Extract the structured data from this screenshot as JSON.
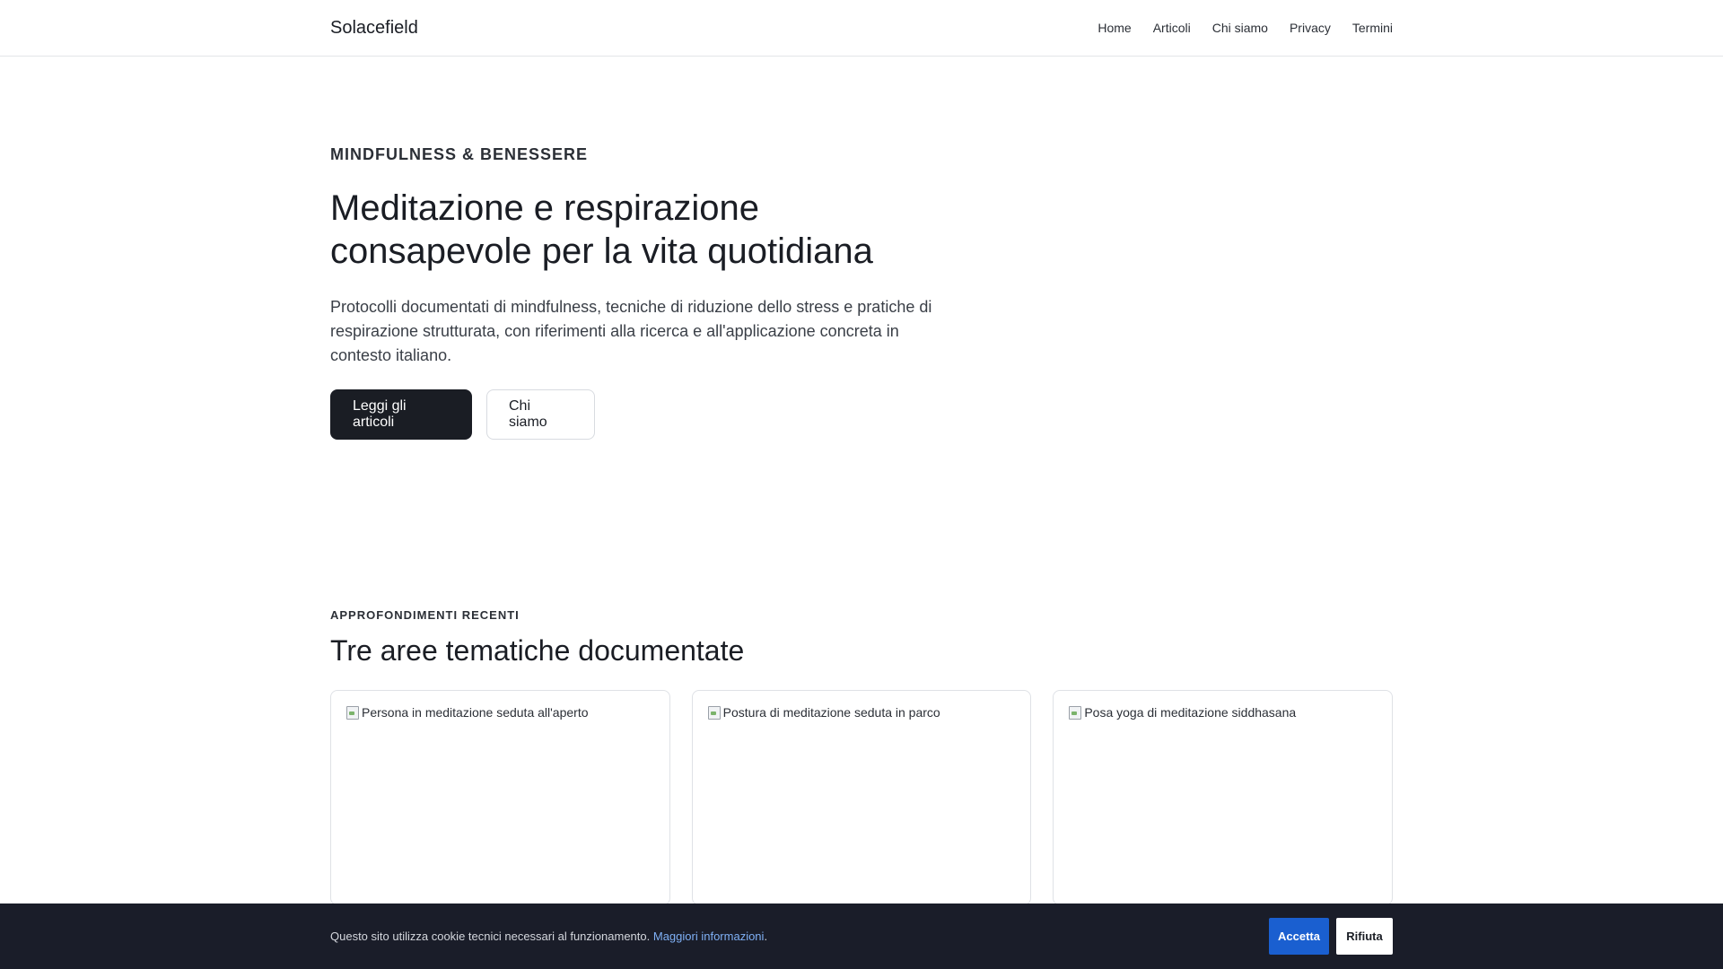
{
  "header": {
    "brand": "Solacefield",
    "nav": [
      "Home",
      "Articoli",
      "Chi siamo",
      "Privacy",
      "Termini"
    ]
  },
  "hero": {
    "eyebrow": "MINDFULNESS & BENESSERE",
    "title": "Meditazione e respirazione consapevole per la vita quotidiana",
    "lead": "Protocolli documentati di mindfulness, tecniche di riduzione dello stress e pratiche di respirazione strutturata, con riferimenti alla ricerca e all'applicazione concreta in contesto italiano.",
    "primary_button": "Leggi gli articoli",
    "secondary_button": "Chi siamo"
  },
  "recent": {
    "eyebrow": "APPROFONDIMENTI RECENTI",
    "title": "Tre aree tematiche documentate",
    "cards": [
      {
        "image_alt": "Persona in meditazione seduta all'aperto"
      },
      {
        "image_alt": "Postura di meditazione seduta in parco"
      },
      {
        "image_alt": "Posa yoga di meditazione siddhasana"
      }
    ]
  },
  "cookie": {
    "text": "Questo sito utilizza cookie tecnici necessari al funzionamento.",
    "link": "Maggiori informazioni",
    "accept": "Accetta",
    "reject": "Rifiuta"
  },
  "colors": {
    "primary_dark": "#1a1d24",
    "cookie_bar_bg": "#1a1d29",
    "accept_blue": "#1a5fd0",
    "link_blue": "#7fb0f5"
  }
}
